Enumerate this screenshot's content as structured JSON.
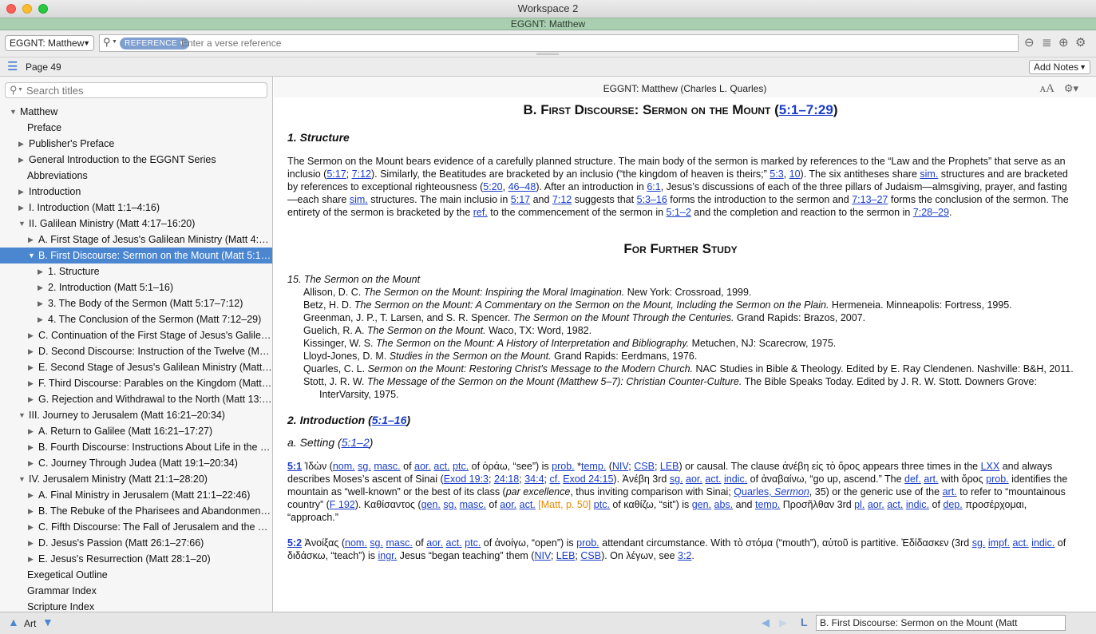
{
  "window": {
    "title": "Workspace 2",
    "subtitle": "EGGNT: Matthew"
  },
  "toolbar": {
    "resource": "EGGNT: Matthew",
    "ref_pill": "REFERENCE",
    "verse_placeholder": "Enter a verse reference"
  },
  "pagebar": {
    "page": "Page 49",
    "add_notes": "Add Notes"
  },
  "sidebar": {
    "search_placeholder": "Search titles",
    "tree": [
      {
        "label": "Matthew",
        "depth": 0,
        "state": "open"
      },
      {
        "label": "Preface",
        "depth": 1,
        "state": "leaf"
      },
      {
        "label": "Publisher's Preface",
        "depth": 1,
        "state": "closed"
      },
      {
        "label": "General Introduction to the EGGNT Series",
        "depth": 1,
        "state": "closed"
      },
      {
        "label": "Abbreviations",
        "depth": 1,
        "state": "leaf"
      },
      {
        "label": "Introduction",
        "depth": 1,
        "state": "closed"
      },
      {
        "label": "I. Introduction (Matt 1:1–4:16)",
        "depth": 1,
        "state": "closed"
      },
      {
        "label": "II. Galilean Ministry (Matt 4:17–16:20)",
        "depth": 1,
        "state": "open"
      },
      {
        "label": "A. First Stage of Jesus's Galilean Ministry (Matt 4:17…",
        "depth": 2,
        "state": "closed"
      },
      {
        "label": "B. First Discourse: Sermon on the Mount (Matt 5:1–…",
        "depth": 2,
        "state": "open",
        "selected": true
      },
      {
        "label": "1. Structure",
        "depth": 3,
        "state": "closed"
      },
      {
        "label": "2. Introduction (Matt 5:1–16)",
        "depth": 3,
        "state": "closed"
      },
      {
        "label": "3. The Body of the Sermon (Matt 5:17–7:12)",
        "depth": 3,
        "state": "closed"
      },
      {
        "label": "4. The Conclusion of the Sermon (Matt 7:12–29)",
        "depth": 3,
        "state": "closed"
      },
      {
        "label": "C. Continuation of the First Stage of Jesus's Galilea…",
        "depth": 2,
        "state": "closed"
      },
      {
        "label": "D. Second Discourse: Instruction of the Twelve (Mat…",
        "depth": 2,
        "state": "closed"
      },
      {
        "label": "E. Second Stage of Jesus's Galilean Ministry (Matt 1…",
        "depth": 2,
        "state": "closed"
      },
      {
        "label": "F. Third Discourse: Parables on the Kingdom (Matt 1…",
        "depth": 2,
        "state": "closed"
      },
      {
        "label": "G. Rejection and Withdrawal to the North (Matt 13:5…",
        "depth": 2,
        "state": "closed"
      },
      {
        "label": "III. Journey to Jerusalem (Matt 16:21–20:34)",
        "depth": 1,
        "state": "open"
      },
      {
        "label": "A. Return to Galilee (Matt 16:21–17:27)",
        "depth": 2,
        "state": "closed"
      },
      {
        "label": "B. Fourth Discourse: Instructions About Life in the K…",
        "depth": 2,
        "state": "closed"
      },
      {
        "label": "C. Journey Through Judea (Matt 19:1–20:34)",
        "depth": 2,
        "state": "closed"
      },
      {
        "label": "IV. Jerusalem Ministry (Matt 21:1–28:20)",
        "depth": 1,
        "state": "open"
      },
      {
        "label": "A. Final Ministry in Jerusalem (Matt 21:1–22:46)",
        "depth": 2,
        "state": "closed"
      },
      {
        "label": "B. The Rebuke of the Pharisees and Abandonment…",
        "depth": 2,
        "state": "closed"
      },
      {
        "label": "C. Fifth Discourse: The Fall of Jerusalem and the Co…",
        "depth": 2,
        "state": "closed"
      },
      {
        "label": "D. Jesus's Passion (Matt 26:1–27:66)",
        "depth": 2,
        "state": "closed"
      },
      {
        "label": "E. Jesus's Resurrection (Matt 28:1–20)",
        "depth": 2,
        "state": "closed"
      },
      {
        "label": "Exegetical Outline",
        "depth": 1,
        "state": "leaf"
      },
      {
        "label": "Grammar Index",
        "depth": 1,
        "state": "leaf"
      },
      {
        "label": "Scripture Index",
        "depth": 1,
        "state": "leaf"
      }
    ]
  },
  "content": {
    "header": "EGGNT: Matthew (Charles L. Quarles)",
    "heading_main": "B. First Discourse: Sermon on the Mount (",
    "heading_main_ref": "5:1–7:29",
    "heading_close": ")",
    "structure_heading": "1. Structure",
    "further_study": "For Further Study",
    "bib_heading": "15. The Sermon on the Mount",
    "bibliography": [
      {
        "author": "Allison, D. C. ",
        "title": "The Sermon on the Mount: Inspiring the Moral Imagination.",
        "rest": " New York: Crossroad, 1999."
      },
      {
        "author": "Betz, H. D. ",
        "title": "The Sermon on the Mount: A Commentary on the Sermon on the Mount, Including the Sermon on the Plain.",
        "rest": " Hermeneia. Minneapolis: Fortress, 1995."
      },
      {
        "author": "Greenman, J. P., T. Larsen, and S. R. Spencer. ",
        "title": "The Sermon on the Mount Through the Centuries.",
        "rest": " Grand Rapids: Brazos, 2007."
      },
      {
        "author": "Guelich, R. A. ",
        "title": "The Sermon on the Mount.",
        "rest": " Waco, TX: Word, 1982."
      },
      {
        "author": "Kissinger, W. S. ",
        "title": "The Sermon on the Mount: A History of Interpretation and Bibliography.",
        "rest": " Metuchen, NJ: Scarecrow, 1975."
      },
      {
        "author": "Lloyd-Jones, D. M. ",
        "title": "Studies in the Sermon on the Mount.",
        "rest": " Grand Rapids: Eerdmans, 1976."
      },
      {
        "author": "Quarles, C. L. ",
        "title": "Sermon on the Mount: Restoring Christ's Message to the Modern Church.",
        "rest": " NAC Studies in Bible & Theology. Edited by E. Ray Clendenen. Nashville: B&H, 2011."
      },
      {
        "author": "Stott, J. R. W. ",
        "title": "The Message of the Sermon on the Mount (Matthew 5–7): Christian Counter-Culture.",
        "rest": " The Bible Speaks Today. Edited by J. R. W. Stott. Downers Grove: InterVarsity, 1975."
      }
    ],
    "intro_heading": "2. Introduction (",
    "intro_ref": "5:1–16",
    "setting_heading": "a. Setting (",
    "setting_ref": "5:1–2"
  },
  "statusbar": {
    "left": "Art",
    "location": "B. First Discourse: Sermon on the Mount (Matt"
  },
  "colors": {
    "selection": "#4b86d1",
    "link": "#1a3cc8",
    "subbar": "#a9ceb0"
  }
}
